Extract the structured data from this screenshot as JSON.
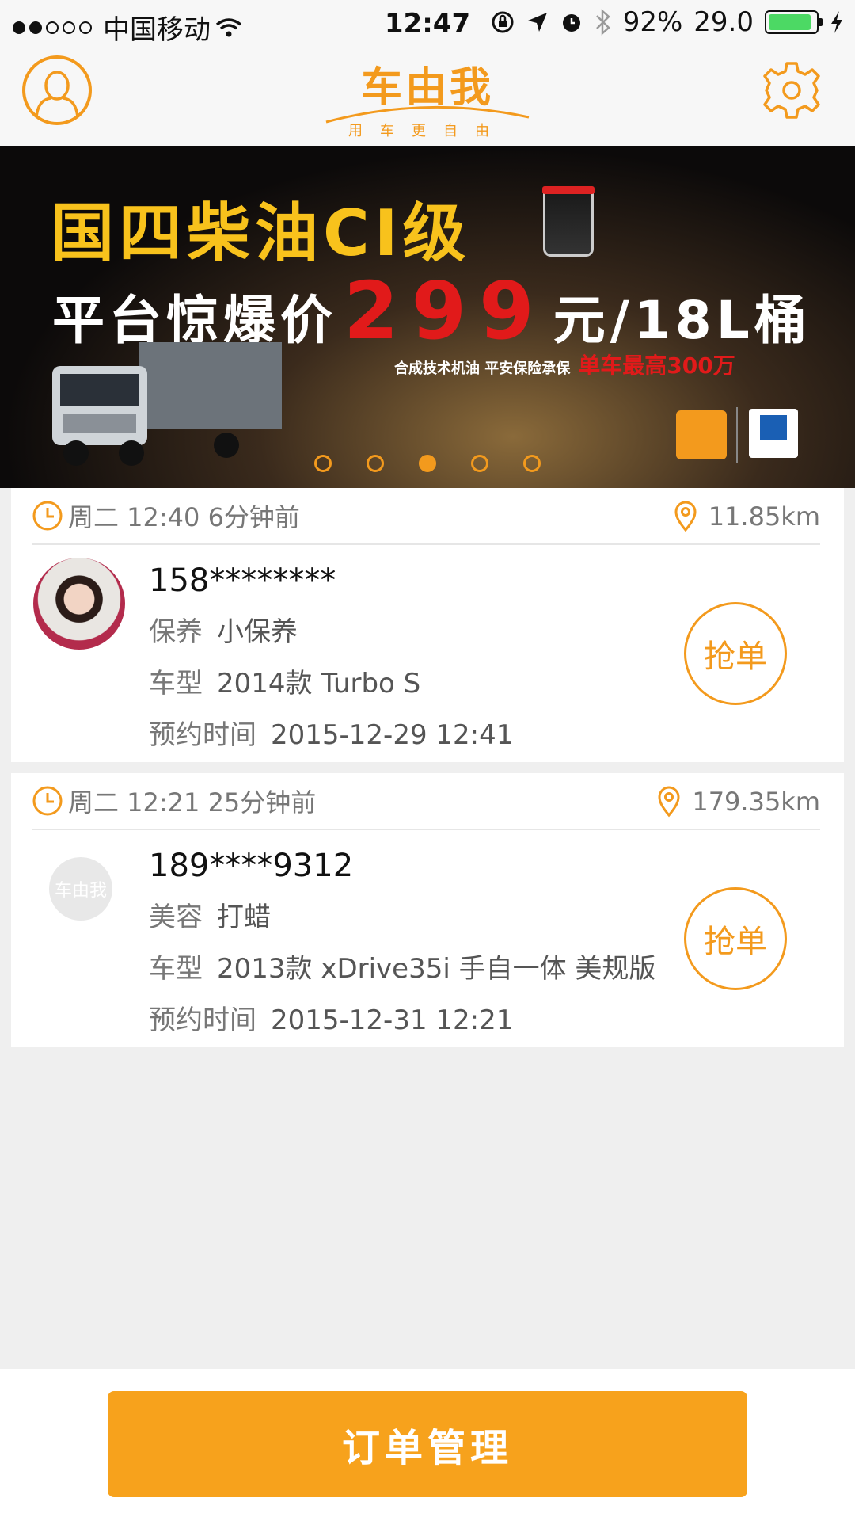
{
  "status_bar": {
    "carrier": "中国移动",
    "time": "12:47",
    "battery_percent": "92%",
    "extra_value": "29.0",
    "battery_level": 0.92
  },
  "header": {
    "logo_title": "车由我",
    "logo_subtitle": "用车更自由",
    "profile_icon": "user-icon",
    "settings_icon": "gear-icon"
  },
  "banner": {
    "line1": "国四柴油CI级",
    "line2_prefix": "平台惊爆价",
    "line2_price": "299",
    "line2_suffix": "元/18L桶",
    "line3_left": "合成技术机油 平安保险承保",
    "line3_red": "单车最高300万",
    "slide_count": 5,
    "active_slide": 3
  },
  "orders": [
    {
      "day_time": "周二 12:40 6分钟前",
      "distance": "11.85km",
      "phone": "158********",
      "service_label": "保养",
      "service_value": "小保养",
      "car_label": "车型",
      "car_value": "2014款 Turbo S",
      "appt_label": "预约时间",
      "appt_value": "2015-12-29 12:41",
      "grab_label": "抢单",
      "avatar": "photo"
    },
    {
      "day_time": "周二 12:21 25分钟前",
      "distance": "179.35km",
      "phone": "189****9312",
      "service_label": "美容",
      "service_value": "打蜡",
      "car_label": "车型",
      "car_value": "2013款 xDrive35i 手自一体 美规版",
      "appt_label": "预约时间",
      "appt_value": "2015-12-31 12:21",
      "grab_label": "抢单",
      "avatar_text": "车由我"
    }
  ],
  "bottom": {
    "order_management": "订单管理"
  },
  "colors": {
    "accent": "#f39a1d",
    "button": "#f7a21c",
    "price_red": "#e11a1a"
  }
}
